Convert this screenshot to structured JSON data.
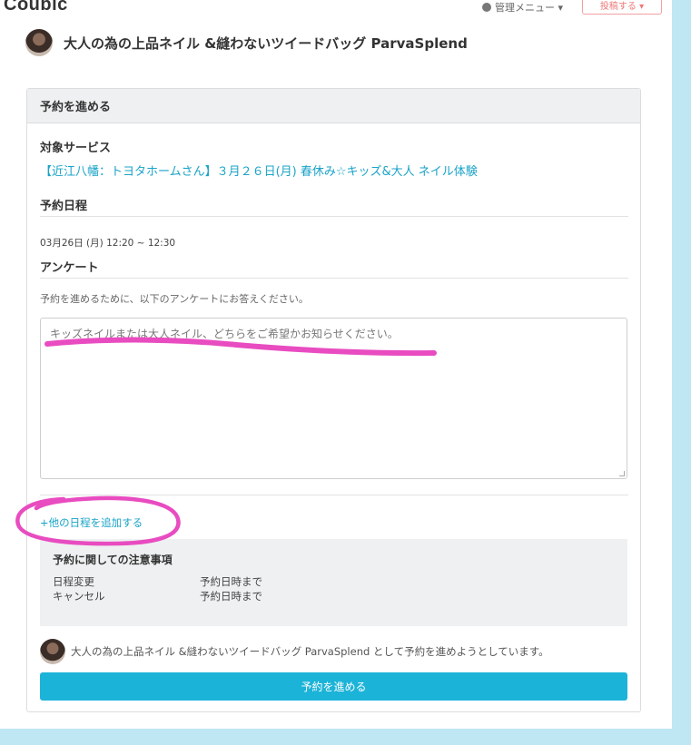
{
  "header": {
    "logo": "Coubic",
    "admin_menu": "管理メニュー ▾",
    "post_button": "投稿する ▾"
  },
  "shop": {
    "name": "大人の為の上品ネイル &縫わないツイードバッグ ParvaSplend"
  },
  "card": {
    "title": "予約を進める",
    "service_label": "対象サービス",
    "service_link": "【近江八幡：トヨタホームさん】３月２６日(月) 春休み☆キッズ&大人 ネイル体験",
    "schedule_label": "予約日程",
    "schedule_value": "03月26日 (月) 12:20 ~ 12:30",
    "survey_label": "アンケート",
    "survey_hint": "予約を進めるために、以下のアンケートにお答えください。",
    "survey_placeholder": "キッズネイルまたは大人ネイル、どちらをご希望かお知らせください。",
    "add_schedule_link": "+他の日程を追加する",
    "notes": {
      "title": "予約に関しての注意事項",
      "rows": [
        {
          "key": "日程変更",
          "value": "予約日時まで"
        },
        {
          "key": "キャンセル",
          "value": "予約日時まで"
        }
      ]
    },
    "confirm_text": "大人の為の上品ネイル &縫わないツイードバッグ ParvaSplend として予約を進めようとしています。",
    "submit_button": "予約を進める"
  },
  "colors": {
    "accent": "#1cb3d8",
    "link": "#1aa3c8",
    "annotation": "#e84cc0",
    "background": "#bfe6f3"
  }
}
